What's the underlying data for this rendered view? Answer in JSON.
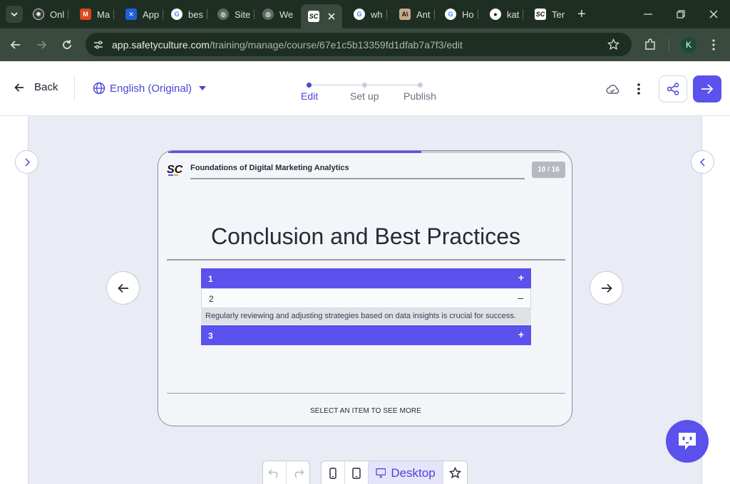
{
  "browser": {
    "tabs": [
      {
        "label": "Onl",
        "icon": "spark-icon",
        "color": "#3a3a3a"
      },
      {
        "label": "Ma",
        "icon": "make-icon",
        "color": "#d9481c"
      },
      {
        "label": "App",
        "icon": "butterfly-icon",
        "color": "#1f5fd9"
      },
      {
        "label": "bes",
        "icon": "google-icon",
        "color": "#ffffff"
      },
      {
        "label": "Site",
        "icon": "globe-icon",
        "color": "#5f6b62"
      },
      {
        "label": "We",
        "icon": "globe-icon",
        "color": "#5f6b62"
      },
      {
        "label": "",
        "icon": "safetyculture-icon",
        "color": "#ffffff"
      },
      {
        "label": "wh",
        "icon": "google-icon",
        "color": "#ffffff"
      },
      {
        "label": "Ant",
        "icon": "anthropic-icon",
        "color": "#c7a98a"
      },
      {
        "label": "Ho",
        "icon": "google-icon",
        "color": "#ffffff"
      },
      {
        "label": "kat",
        "icon": "github-icon",
        "color": "#ffffff"
      },
      {
        "label": "Ter",
        "icon": "safetyculture-icon",
        "color": "#ffffff"
      }
    ],
    "url_host": "app.safetyculture.com",
    "url_path": "/training/manage/course/67e1c5b13359fd1dfab7a7f3/edit",
    "profile_initial": "K"
  },
  "header": {
    "back_label": "Back",
    "language_label": "English (Original)",
    "steps": [
      "Edit",
      "Set up",
      "Publish"
    ],
    "active_step": "Edit"
  },
  "slide": {
    "course_title": "Foundations of Digital Marketing Analytics",
    "counter": "10 / 16",
    "progress": 0.64,
    "title": "Conclusion and Best Practices",
    "items": [
      {
        "number": "1",
        "toggle": "+",
        "expanded": false
      },
      {
        "number": "2",
        "toggle": "–",
        "expanded": true,
        "body": "Regularly reviewing and adjusting strategies based on data insights is crucial for success."
      },
      {
        "number": "3",
        "toggle": "+",
        "expanded": false
      }
    ],
    "footer_hint": "SELECT AN ITEM TO SEE MORE"
  },
  "toolbar": {
    "view_label": "Desktop"
  },
  "colors": {
    "accent": "#5b51ec",
    "browser_dark": "#1f2e22",
    "canvas_bg": "#e9ebf5"
  }
}
